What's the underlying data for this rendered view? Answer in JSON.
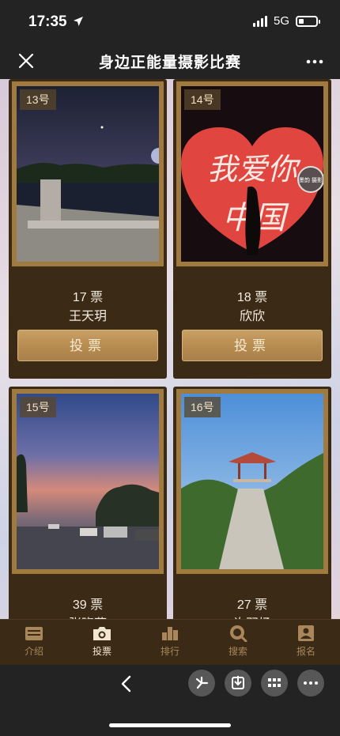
{
  "status": {
    "time": "17:35",
    "network": "5G"
  },
  "nav": {
    "title": "身边正能量摄影比赛"
  },
  "entries": [
    {
      "number": "13号",
      "votes": "17 票",
      "name": "王天玥",
      "vote_label": "投票"
    },
    {
      "number": "14号",
      "votes": "18 票",
      "name": "欣欣",
      "vote_label": "投票",
      "photo_text_1": "我爱你",
      "photo_text_2": "中国",
      "watermark": "墨韵 摄影"
    },
    {
      "number": "15号",
      "votes": "39 票",
      "name": "张晓燕"
    },
    {
      "number": "16号",
      "votes": "27 票",
      "name": "许羽扬"
    }
  ],
  "tabs": [
    {
      "label": "介绍",
      "icon": "intro-icon"
    },
    {
      "label": "投票",
      "icon": "camera-icon"
    },
    {
      "label": "排行",
      "icon": "ranking-icon"
    },
    {
      "label": "搜索",
      "icon": "search-icon"
    },
    {
      "label": "报名",
      "icon": "signup-icon"
    }
  ],
  "active_tab": "投票",
  "colors": {
    "card_bg": "#3a2a16",
    "gold": "#b88d52",
    "frame": "#a07a3e",
    "tab_active": "#f2e6cf",
    "tab_inactive": "#a9875a"
  }
}
